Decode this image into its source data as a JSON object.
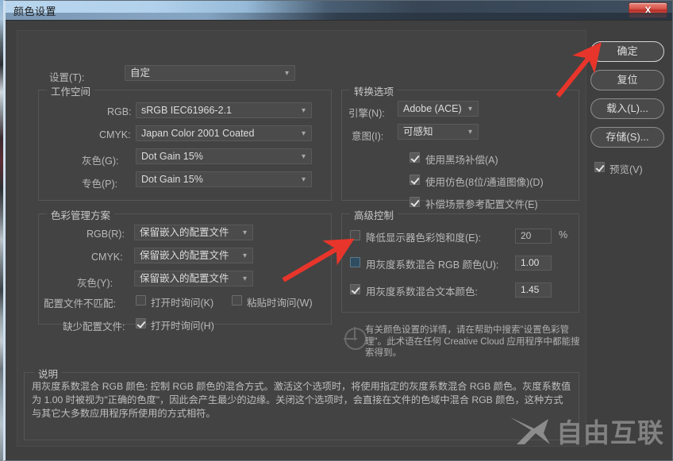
{
  "window": {
    "title": "颜色设置",
    "close_label": "X"
  },
  "settings_row": {
    "label": "设置(T):",
    "value": "自定"
  },
  "working_spaces": {
    "title": "工作空间",
    "rows": [
      {
        "label": "RGB:",
        "value": "sRGB IEC61966-2.1"
      },
      {
        "label": "CMYK:",
        "value": "Japan Color 2001 Coated"
      },
      {
        "label": "灰色(G):",
        "value": "Dot Gain 15%"
      },
      {
        "label": "专色(P):",
        "value": "Dot Gain 15%"
      }
    ]
  },
  "color_management": {
    "title": "色彩管理方案",
    "rows": [
      {
        "label": "RGB(R):",
        "value": "保留嵌入的配置文件"
      },
      {
        "label": "CMYK:",
        "value": "保留嵌入的配置文件"
      },
      {
        "label": "灰色(Y):",
        "value": "保留嵌入的配置文件"
      }
    ],
    "mismatch_label": "配置文件不匹配:",
    "mismatch_open": "打开时询问(K)",
    "mismatch_paste": "粘贴时询问(W)",
    "missing_label": "缺少配置文件:",
    "missing_open": "打开时询问(H)"
  },
  "conversion": {
    "title": "转换选项",
    "engine_label": "引擎(N):",
    "engine_value": "Adobe (ACE)",
    "intent_label": "意图(I):",
    "intent_value": "可感知",
    "checks": [
      {
        "label": "使用黑场补偿(A)",
        "checked": true
      },
      {
        "label": "使用仿色(8位/通道图像)(D)",
        "checked": true
      },
      {
        "label": "补偿场景参考配置文件(E)",
        "checked": true
      }
    ]
  },
  "advanced": {
    "title": "高级控制",
    "rows": [
      {
        "label": "降低显示器色彩饱和度(E):",
        "checked": false,
        "value": "20",
        "unit": "%"
      },
      {
        "label": "用灰度系数混合 RGB 颜色(U):",
        "checked": false,
        "value": "1.00",
        "unit": ""
      },
      {
        "label": "用灰度系数混合文本颜色:",
        "checked": true,
        "value": "1.45",
        "unit": ""
      }
    ]
  },
  "info_note": "有关颜色设置的详情，请在帮助中搜索\"设置色彩管理\"。此术语在任何 Creative Cloud 应用程序中都能搜索得到。",
  "description": {
    "title": "说明",
    "text": "用灰度系数混合 RGB 颜色: 控制 RGB 颜色的混合方式。激活这个选项时，将使用指定的灰度系数混合 RGB 颜色。灰度系数值为 1.00 时被视为\"正确的色度\"，因此会产生最少的边缘。关闭这个选项时，会直接在文件的色域中混合 RGB 颜色，这种方式与其它大多数应用程序所使用的方式相符。"
  },
  "buttons": {
    "ok": "确定",
    "reset": "复位",
    "load": "载入(L)...",
    "save": "存储(S)...",
    "preview": "预览(V)",
    "preview_checked": true
  },
  "watermark": {
    "text": "自由互联"
  },
  "colors": {
    "accent_red": "#e8352b",
    "dialog_bg": "#434343",
    "field_bg": "#4b4b4b"
  }
}
